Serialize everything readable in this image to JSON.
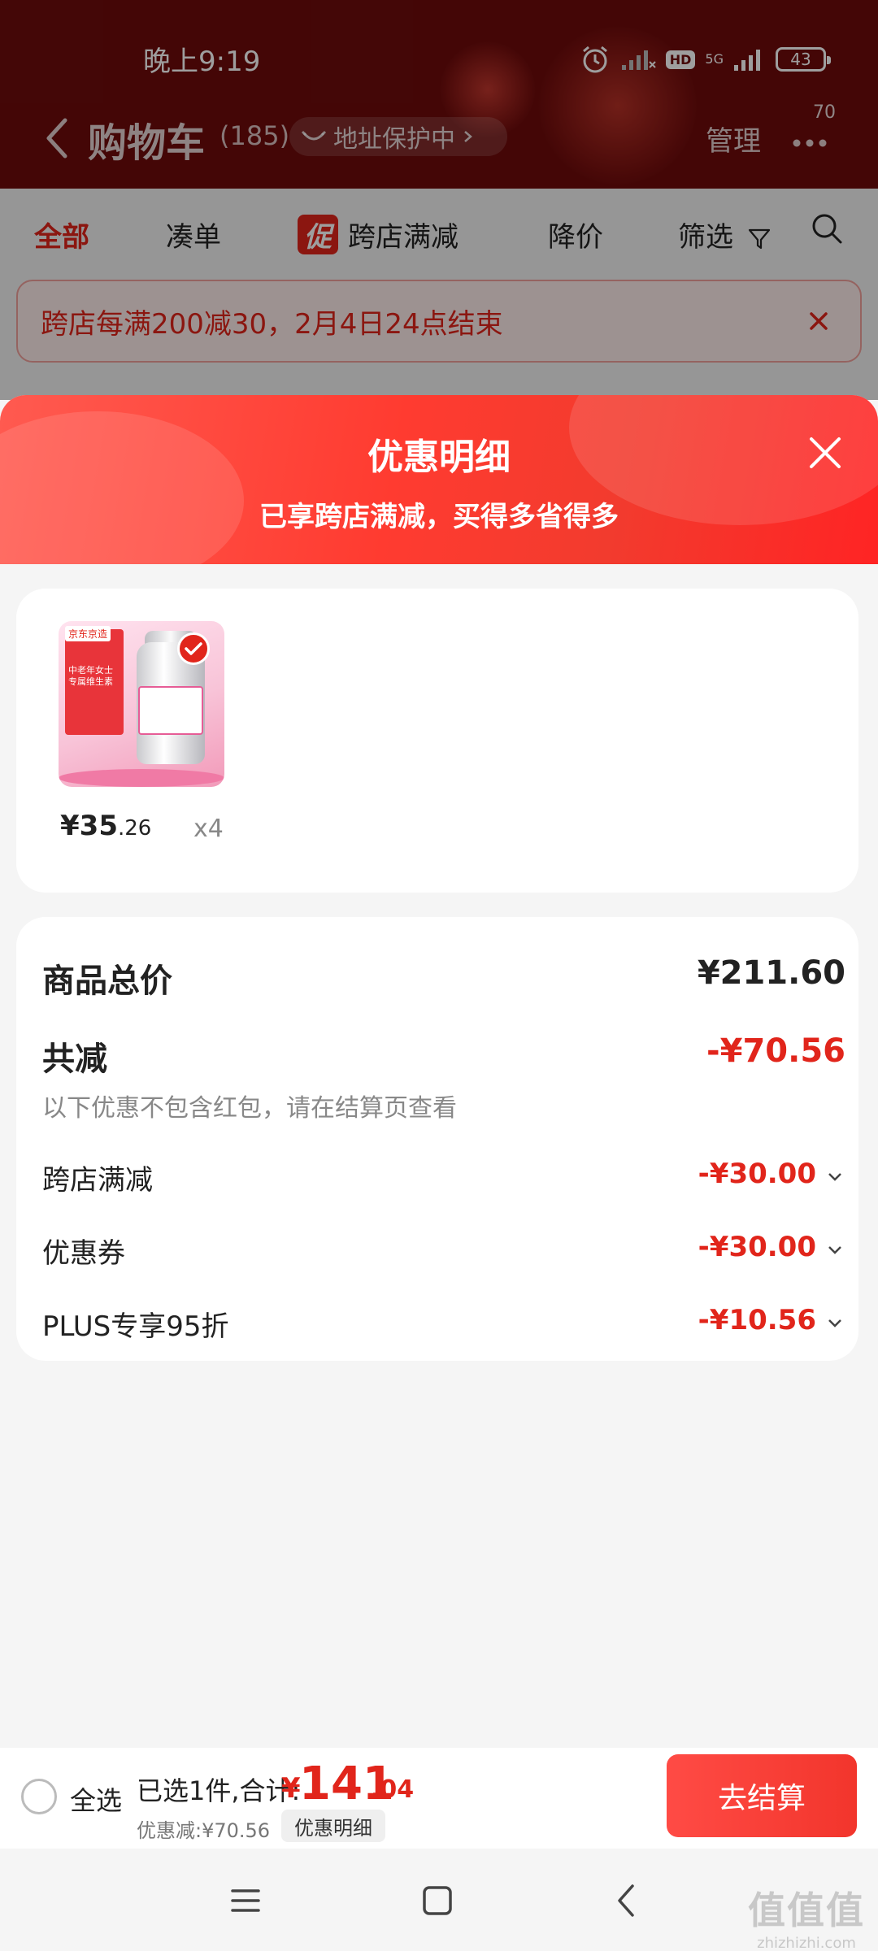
{
  "status_bar": {
    "time": "晚上9:19",
    "network": "5G",
    "hd": "HD",
    "battery": "43"
  },
  "nav": {
    "title": "购物车",
    "count": "(185)",
    "address_protect": "地址保护中",
    "manage": "管理",
    "message_badge": "70"
  },
  "filters": {
    "all": "全部",
    "combine": "凑单",
    "promo_chip": "促",
    "cross_store": "跨店满减",
    "price_drop": "降价",
    "filter": "筛选"
  },
  "promo_banner": {
    "text": "跨店每满200减30，2月4日24点结束"
  },
  "sheet": {
    "title": "优惠明细",
    "subtitle": "已享跨店满减，买得多省得多"
  },
  "product": {
    "brand": "京东京造",
    "box_text": "中老年女士专属维生素",
    "price_int": "¥35",
    "price_dec": ".26",
    "quantity": "x4"
  },
  "details": {
    "total_label": "商品总价",
    "total_value": "¥211.60",
    "reduce_label": "共减",
    "reduce_value": "-¥70.56",
    "note": "以下优惠不包含红包，请在结算页查看",
    "items": [
      {
        "label": "跨店满减",
        "value": "-¥30.00"
      },
      {
        "label": "优惠券",
        "value": "-¥30.00"
      },
      {
        "label": "PLUS专享95折",
        "value": "-¥10.56"
      }
    ]
  },
  "checkout": {
    "select_all": "全选",
    "selected_summary": "已选1件,合计:",
    "currency": "¥",
    "total_int": "141",
    "total_dec": ".04",
    "discount": "优惠减:¥70.56",
    "detail_button": "优惠明细",
    "checkout_button": "去结算"
  },
  "watermark": {
    "big": "值值值",
    "small": "zhizhizhi.com"
  },
  "colors": {
    "brand_red": "#e1251b",
    "header_dark": "#6e0b0b",
    "sheet_header": "#ff3b30"
  }
}
